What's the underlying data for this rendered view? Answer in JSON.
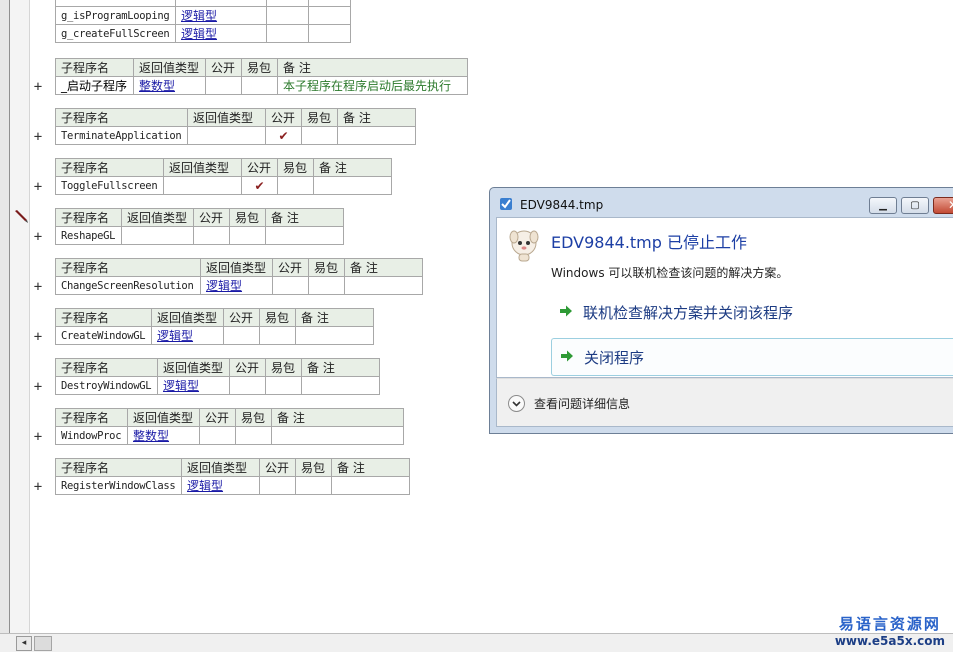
{
  "editor": {
    "header_labels": {
      "sub_name": "子程序名",
      "return_type": "返回值类型",
      "public": "公开",
      "easy_pack": "易包",
      "remark": "备 注"
    },
    "globals_partial": [
      {
        "name": "g_isProgramLooping",
        "type": "逻辑型"
      },
      {
        "name": "g_createFullScreen",
        "type": "逻辑型"
      }
    ],
    "subroutines": [
      {
        "name": "_启动子程序",
        "return_type": "整数型",
        "public": "",
        "easy_pack": "",
        "remark": "本子程序在程序启动后最先执行"
      },
      {
        "name": "TerminateApplication",
        "return_type": "",
        "public": "✔",
        "easy_pack": "",
        "remark": ""
      },
      {
        "name": "ToggleFullscreen",
        "return_type": "",
        "public": "✔",
        "easy_pack": "",
        "remark": ""
      },
      {
        "name": "ReshapeGL",
        "return_type": "",
        "public": "",
        "easy_pack": "",
        "remark": ""
      },
      {
        "name": "ChangeScreenResolution",
        "return_type": "逻辑型",
        "public": "",
        "easy_pack": "",
        "remark": ""
      },
      {
        "name": "CreateWindowGL",
        "return_type": "逻辑型",
        "public": "",
        "easy_pack": "",
        "remark": ""
      },
      {
        "name": "DestroyWindowGL",
        "return_type": "逻辑型",
        "public": "",
        "easy_pack": "",
        "remark": ""
      },
      {
        "name": "WindowProc",
        "return_type": "整数型",
        "public": "",
        "easy_pack": "",
        "remark": ""
      },
      {
        "name": "RegisterWindowClass",
        "return_type": "逻辑型",
        "public": "",
        "easy_pack": "",
        "remark": ""
      }
    ],
    "expand_glyph": "+",
    "scroll_left_glyph": "◂"
  },
  "dialog": {
    "title": "EDV9844.tmp",
    "heading": "EDV9844.tmp 已停止工作",
    "subtext": "Windows 可以联机检查该问题的解决方案。",
    "option_check": "联机检查解决方案并关闭该程序",
    "option_close": "关闭程序",
    "details": "查看问题详细信息",
    "buttons": {
      "minimize": "▁",
      "maximize": "▢",
      "close": "✕"
    }
  },
  "watermark": {
    "cn": "易语言资源网",
    "url": "www.e5a5x.com"
  },
  "colors": {
    "header_bg": "#e8efe6",
    "type_link": "#1a1aa6",
    "comment": "#2c7a2c",
    "check": "#8a1f1f",
    "dialog_frame": "#cfdcec",
    "heading_blue": "#1d3fa5"
  }
}
